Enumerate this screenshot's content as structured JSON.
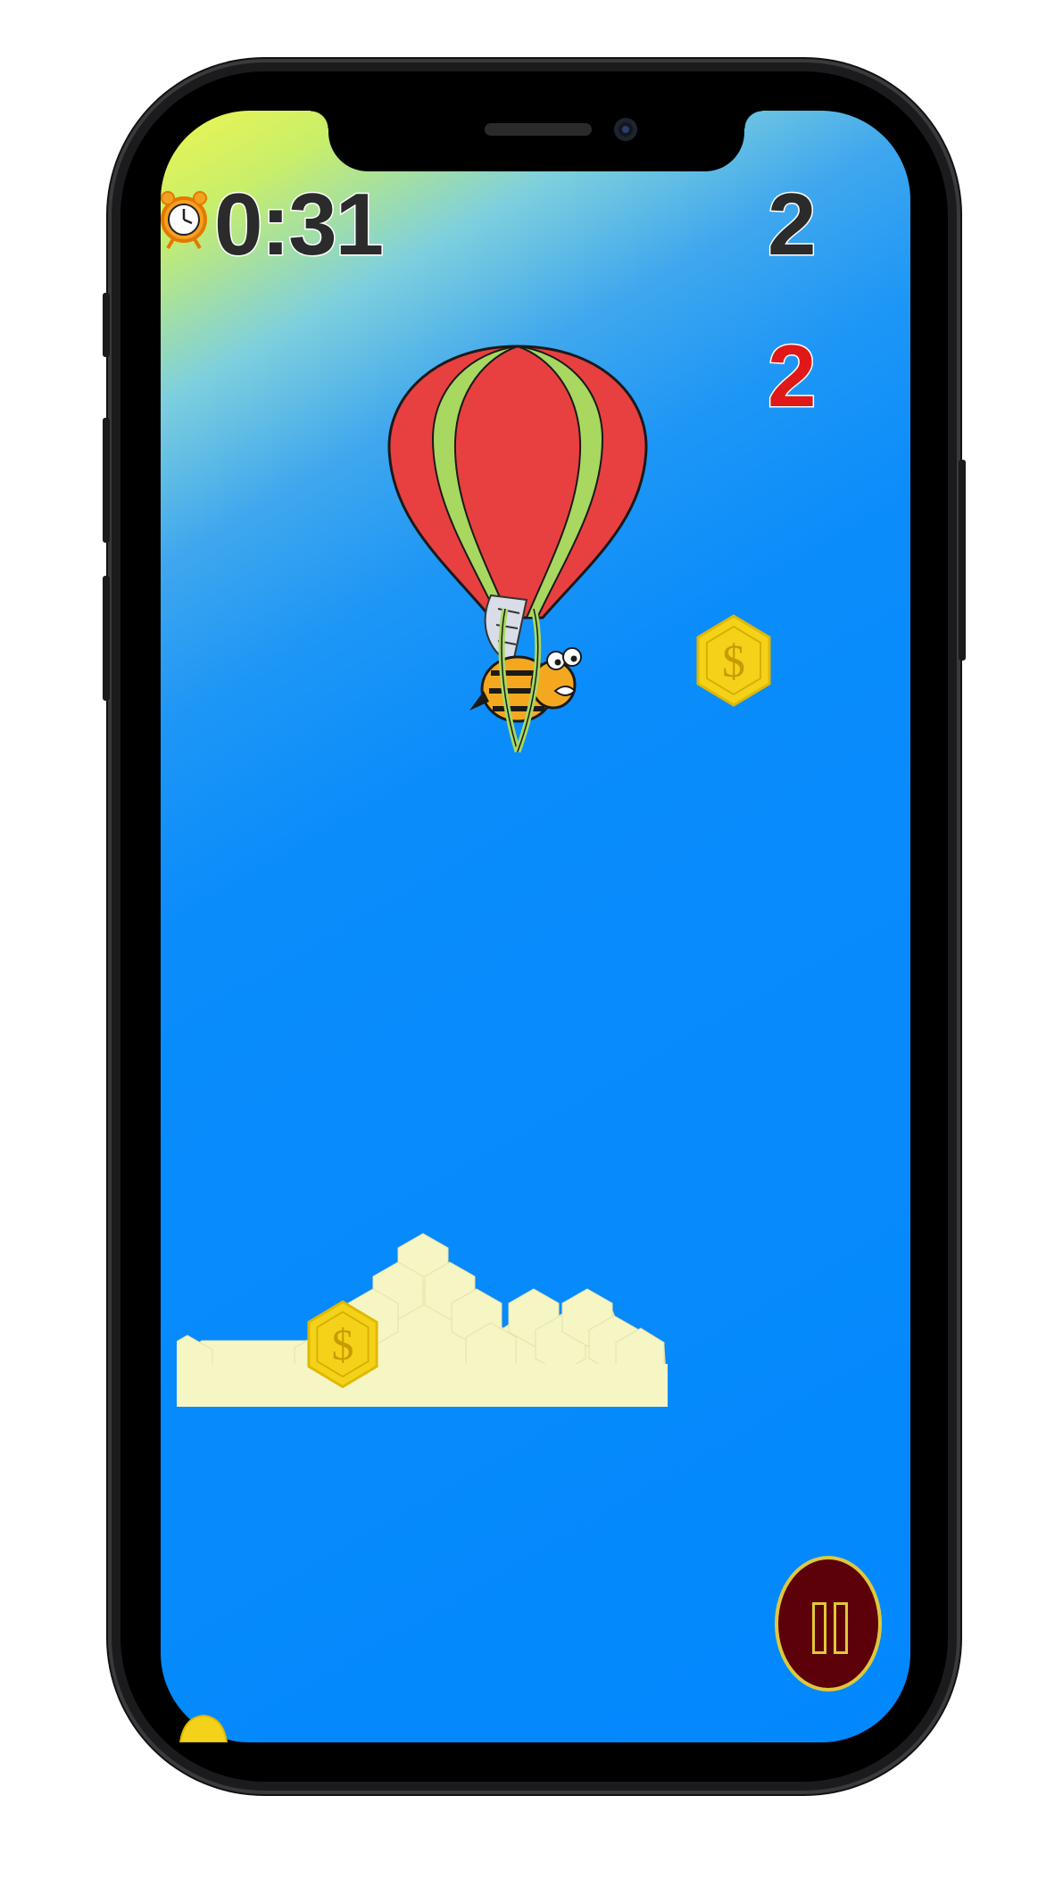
{
  "hud": {
    "timer": "0:31",
    "score_primary": "2",
    "score_secondary": "2"
  },
  "icons": {
    "timer": "alarm-clock-icon",
    "coin": "dollar-coin-icon",
    "pause": "pause-icon"
  },
  "colors": {
    "sky": "#0288fd",
    "balloon_red": "#e84040",
    "balloon_green": "#a8d860",
    "coin_gold": "#f4d21a",
    "cloud": "#f6f5c4",
    "pause_bg": "#5c0009",
    "score_red": "#e01818"
  }
}
